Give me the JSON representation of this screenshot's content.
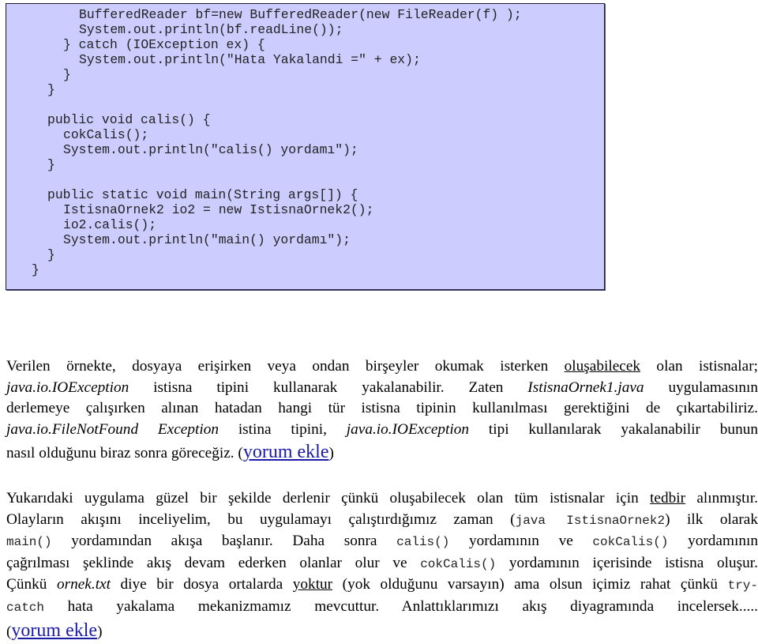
{
  "code_block": {
    "background_color": "#ccccff",
    "lines": [
      {
        "indent": 4,
        "text": "BufferedReader bf=new BufferedReader(new FileReader(f) );"
      },
      {
        "indent": 4,
        "text": "System.out.println(bf.readLine());"
      },
      {
        "indent": 3,
        "text": "} catch (IOException ex) {"
      },
      {
        "indent": 4,
        "text": "System.out.println(\"Hata Yakalandi =\" + ex);"
      },
      {
        "indent": 3,
        "text": "}"
      },
      {
        "indent": 2,
        "text": "}"
      },
      {
        "indent": 0,
        "text": ""
      },
      {
        "indent": 2,
        "text": "public void calis() {"
      },
      {
        "indent": 3,
        "text": "cokCalis();"
      },
      {
        "indent": 3,
        "text": "System.out.println(\"calis() yordamı\");"
      },
      {
        "indent": 2,
        "text": "}"
      },
      {
        "indent": 0,
        "text": ""
      },
      {
        "indent": 2,
        "text": "public static void main(String args[]) {"
      },
      {
        "indent": 3,
        "text": "IstisnaOrnek2 io2 = new IstisnaOrnek2();"
      },
      {
        "indent": 3,
        "text": "io2.calis();"
      },
      {
        "indent": 3,
        "text": "System.out.println(\"main() yordamı\");"
      },
      {
        "indent": 2,
        "text": "}"
      },
      {
        "indent": 1,
        "text": "}"
      }
    ]
  },
  "paragraph1": {
    "l1_a": "Verilen örnekte, dosyaya erişirken veya ondan birşeyler okumak isterken ",
    "l1_u": "oluşabilecek",
    "l1_b": " olan istisnalar;",
    "l2_i1": "java.io.IOException",
    "l2_a": " istisna tipini kullanarak yakalanabilir. Zaten ",
    "l2_i2": "IstisnaOrnek1.java",
    "l2_b": " uygulamasının",
    "l3": "derlemeye çalışırken alınan hatadan hangi tür istisna tipinin kullanılması gerektiğini de çıkartabiliriz.",
    "l4_i1": "java.io.FileNotFound Exception",
    "l4_a": " istina tipini, ",
    "l4_i2": "java.io.IOException",
    "l4_b": " tipi kullanılarak yakalanabilir bunun",
    "l5_a": "nasıl olduğunu biraz sonra göreceğiz. (",
    "l5_link": "yorum ekle",
    "l5_b": ")"
  },
  "paragraph2": {
    "l1_a": "Yukarıdaki uygulama güzel bir şekilde derlenir çünkü oluşabilecek olan tüm istisnalar için ",
    "l1_u": "tedbir",
    "l1_b": " alınmıştır.",
    "l2_a": "Olayların akışını inceliyelim, bu uygulamayı çalıştırdığımız zaman (",
    "l2_m": "java IstisnaOrnek2",
    "l2_b": ") ilk olarak",
    "l3_m1": "main()",
    "l3_a": " yordamından akışa başlanır. Daha sonra ",
    "l3_m2": "calis()",
    "l3_b": " yordamının ve ",
    "l3_m3": "cokCalis()",
    "l3_c": " yordamının",
    "l4_a": "çağrılması şeklinde akış devam ederken olanlar olur ve ",
    "l4_m": "cokCalis()",
    "l4_b": " yordamının içerisinde istisna oluşur.",
    "l5_a": "Çünkü ",
    "l5_i": "ornek.txt",
    "l5_b": " diye bir dosya ortalarda ",
    "l5_u": "yoktur",
    "l5_c": " (yok olduğunu varsayın) ama olsun içimiz rahat çünkü ",
    "l5_m": "try-",
    "l6_m": "catch",
    "l6_a": " hata yakalama mekanizmamız mevcuttur. Anlattıklarımızı akış diyagramında incelersek.....",
    "l7_a": "(",
    "l7_link": "yorum ekle",
    "l7_b": ")"
  },
  "link_color": "#1a1aa6"
}
